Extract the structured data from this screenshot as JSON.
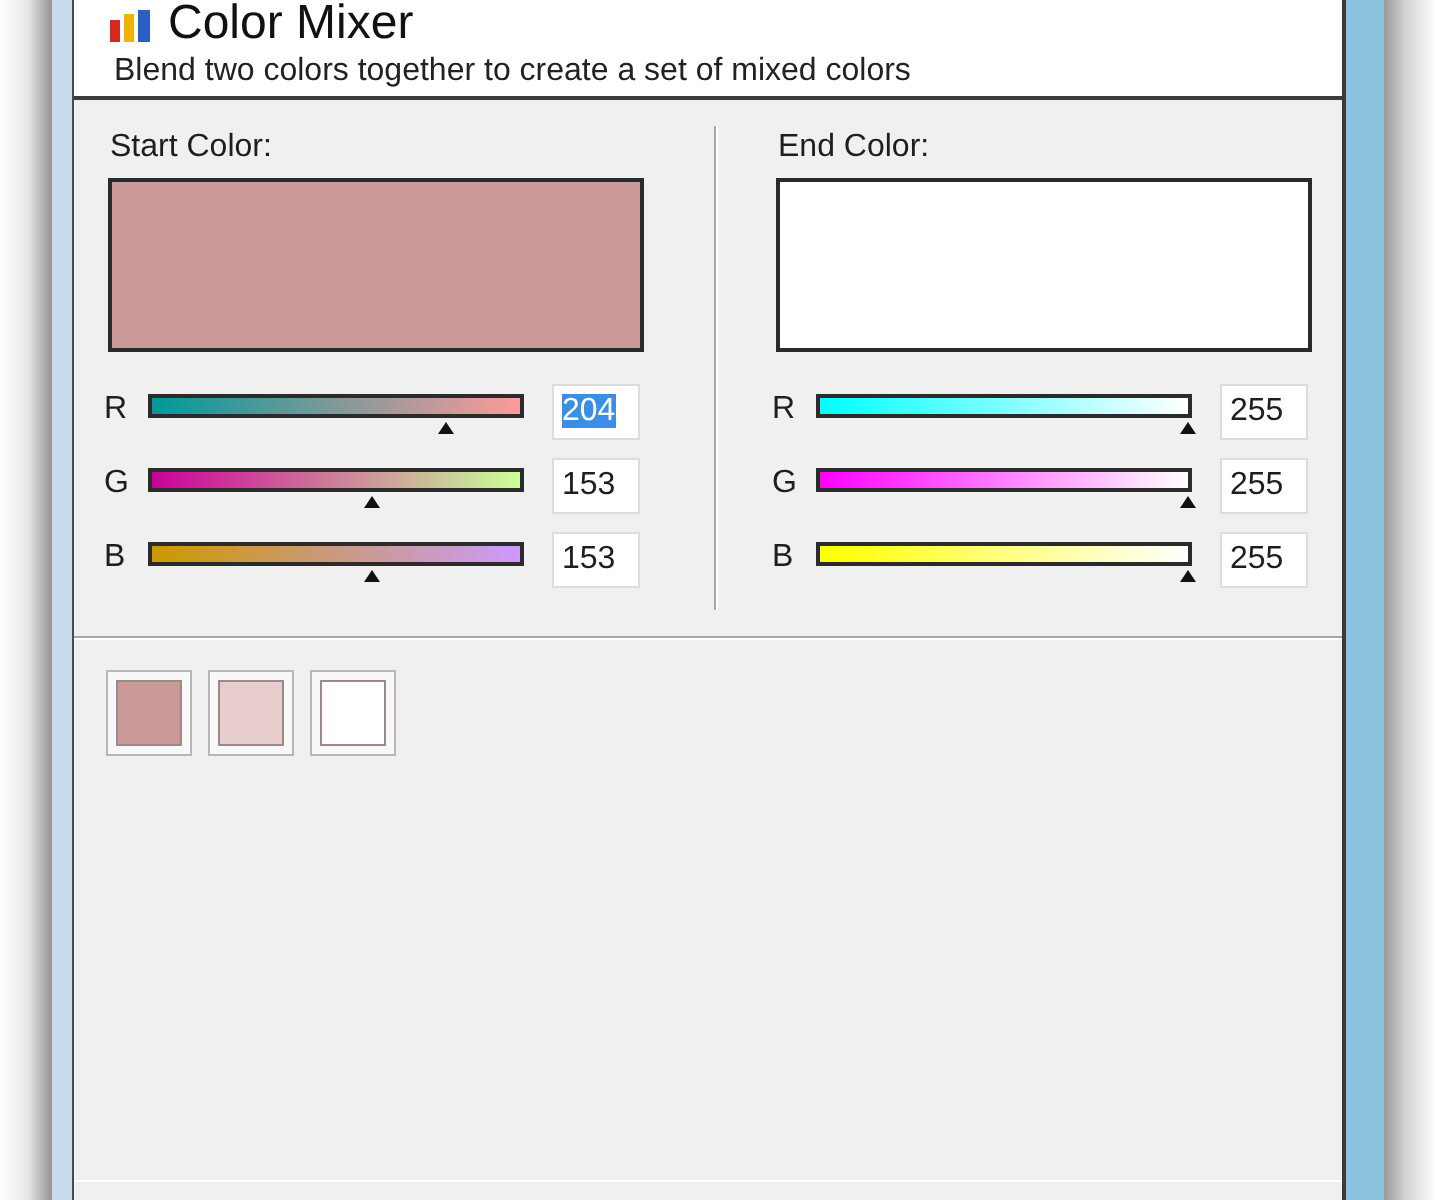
{
  "window": {
    "title": "Color Mixer",
    "subtitle": "Blend two colors together to create a set of mixed colors"
  },
  "panels": [
    {
      "label": "Start Color:",
      "color": "#cc9999",
      "channels": [
        {
          "name": "R",
          "level": 0.8,
          "value": "204",
          "text_selected": true
        },
        {
          "name": "G",
          "level": 0.6,
          "value": "153",
          "text_selected": false
        },
        {
          "name": "B",
          "level": 0.6,
          "value": "153",
          "text_selected": false
        }
      ]
    },
    {
      "label": "End Color:",
      "color": "#ffffff",
      "channels": [
        {
          "name": "R",
          "level": 1,
          "value": "255",
          "text_selected": false
        },
        {
          "name": "G",
          "level": 1,
          "value": "255",
          "text_selected": false
        },
        {
          "name": "B",
          "level": 1,
          "value": "255",
          "text_selected": false
        }
      ]
    }
  ],
  "mixed_colors": [
    {
      "color": "#cc9999"
    },
    {
      "color": "#e6cccc"
    },
    {
      "color": "#ffffff"
    }
  ]
}
